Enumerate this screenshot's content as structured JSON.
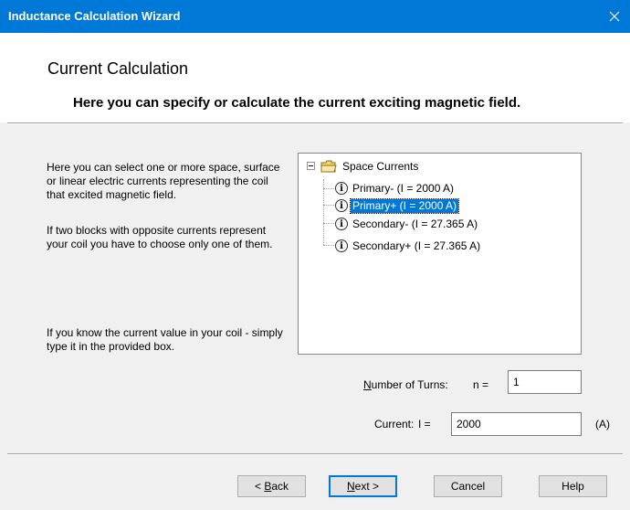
{
  "window": {
    "title": "Inductance Calculation Wizard",
    "close_icon": "close-icon"
  },
  "header": {
    "title": "Current Calculation",
    "subtitle": "Here you can specify or calculate the current exciting magnetic field."
  },
  "description": {
    "para1": "Here you can select one or more space, surface or linear electric currents representing the coil that excited magnetic field.",
    "para2": "If two blocks with opposite currents represent your coil you have to choose only one of them.",
    "para3": "If you know the current value in your coil - simply type it in the provided box."
  },
  "tree": {
    "root": "Space Currents",
    "items": [
      {
        "label": "Primary- (I = 2000 A)",
        "selected": false
      },
      {
        "label": "Primary+ (I = 2000 A)",
        "selected": true
      },
      {
        "label": "Secondary- (I = 27.365 A)",
        "selected": false
      },
      {
        "label": "Secondary+ (I = 27.365 A)",
        "selected": false
      }
    ]
  },
  "turns": {
    "label_prefix": "N",
    "label_rest": "umber of Turns:",
    "var": "n =",
    "value": "1"
  },
  "current": {
    "label": "Current:",
    "var": "I =",
    "value": "2000",
    "unit": "(A)"
  },
  "buttons": {
    "back": {
      "prefix": "< ",
      "mnemonic": "B",
      "rest": "ack"
    },
    "next": {
      "mnemonic": "N",
      "rest": "ext >"
    },
    "cancel": "Cancel",
    "help": "Help"
  }
}
